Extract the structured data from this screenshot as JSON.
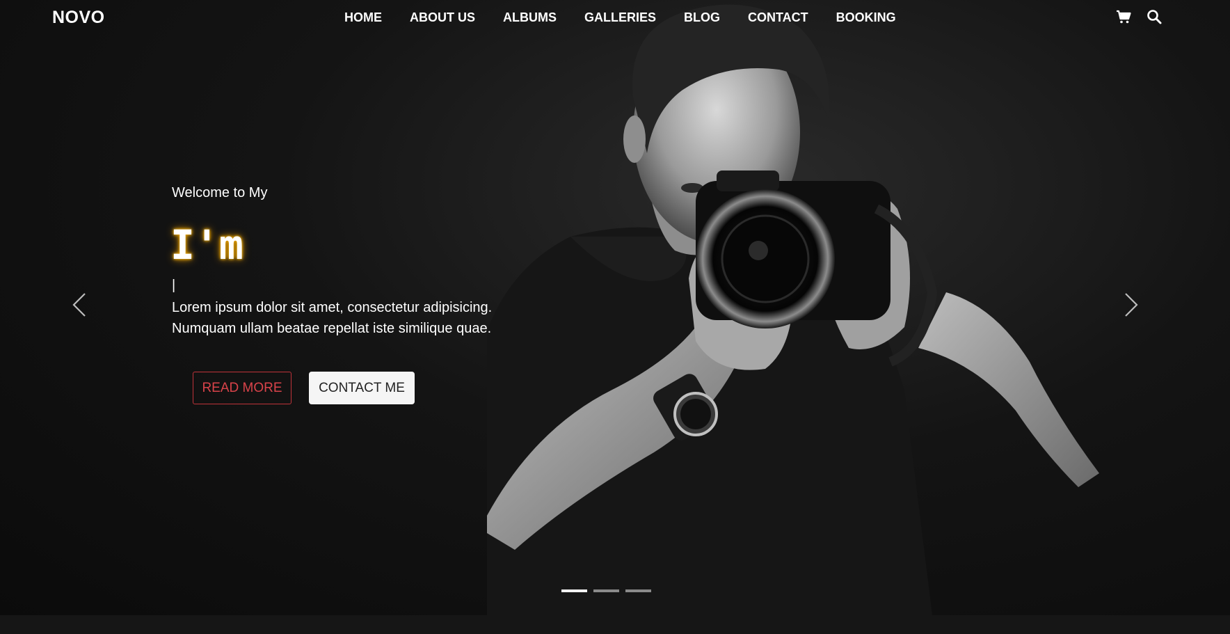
{
  "brand": "NOVO",
  "nav": {
    "links": [
      "HOME",
      "ABOUT US",
      "ALBUMS",
      "GALLERIES",
      "BLOG",
      "CONTACT",
      "BOOKING"
    ],
    "icons": [
      "cart-icon",
      "search-icon"
    ]
  },
  "hero": {
    "welcome": "Welcome to My",
    "headline": "I'm",
    "cursor": "|",
    "description_line1": "Lorem ipsum dolor sit amet, consectetur adipisicing.",
    "description_line2": "Numquam ullam beatae repellat iste similique quae.",
    "read_more_label": "READ MORE",
    "contact_label": "CONTACT ME",
    "slides_total": 3,
    "active_slide": 1
  },
  "colors": {
    "accent_red": "#d9434a",
    "glow": "#e8a200",
    "background": "#0b0b0b"
  }
}
